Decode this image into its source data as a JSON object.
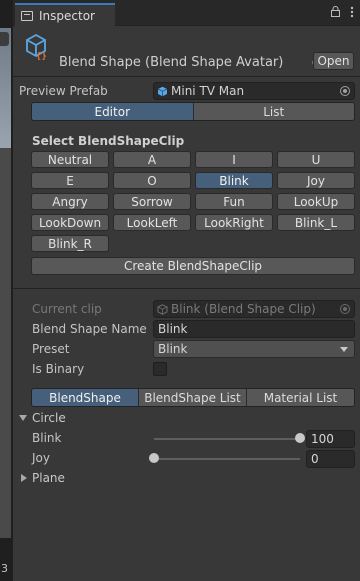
{
  "viewport": {
    "corner_number": "3"
  },
  "tab": {
    "title": "Inspector",
    "lock_icon": "lock-icon",
    "menu_icon": "kebab-menu-icon"
  },
  "header": {
    "title": "Blend Shape (Blend Shape Avatar)",
    "icon": "blendshape-avatar-icon",
    "help_icon": "help-icon",
    "settings_icon": "preset-settings-icon",
    "menu_icon": "kebab-menu-icon",
    "open_label": "Open"
  },
  "preview_prefab": {
    "label": "Preview Prefab",
    "value": "Mini TV Man"
  },
  "mode_tabs": [
    {
      "label": "Editor",
      "active": true
    },
    {
      "label": "List",
      "active": false
    }
  ],
  "clip_section": {
    "title": "Select BlendShapeClip",
    "clips": [
      {
        "label": "Neutral",
        "active": false
      },
      {
        "label": "A",
        "active": false
      },
      {
        "label": "I",
        "active": false
      },
      {
        "label": "U",
        "active": false
      },
      {
        "label": "E",
        "active": false
      },
      {
        "label": "O",
        "active": false
      },
      {
        "label": "Blink",
        "active": true
      },
      {
        "label": "Joy",
        "active": false
      },
      {
        "label": "Angry",
        "active": false
      },
      {
        "label": "Sorrow",
        "active": false
      },
      {
        "label": "Fun",
        "active": false
      },
      {
        "label": "LookUp",
        "active": false
      },
      {
        "label": "LookDown",
        "active": false
      },
      {
        "label": "LookLeft",
        "active": false
      },
      {
        "label": "LookRight",
        "active": false
      },
      {
        "label": "Blink_L",
        "active": false
      },
      {
        "label": "Blink_R",
        "active": false
      }
    ],
    "create_label": "Create BlendShapeClip"
  },
  "clip_props": {
    "current_clip_label": "Current clip",
    "current_clip_value": "Blink (Blend Shape Clip)",
    "blend_shape_name_label": "Blend Shape Name",
    "blend_shape_name_value": "Blink",
    "preset_label": "Preset",
    "preset_value": "Blink",
    "is_binary_label": "Is Binary",
    "is_binary_checked": false
  },
  "sub_tabs": [
    {
      "label": "BlendShape",
      "active": true
    },
    {
      "label": "BlendShape List",
      "active": false
    },
    {
      "label": "Material List",
      "active": false
    }
  ],
  "circle_group": {
    "label": "Circle",
    "expanded": true,
    "shapes": [
      {
        "label": "Blink",
        "value": "100",
        "fraction": 1.0
      },
      {
        "label": "Joy",
        "value": "0",
        "fraction": 0.0
      }
    ]
  },
  "plane_group": {
    "label": "Plane",
    "expanded": false
  }
}
